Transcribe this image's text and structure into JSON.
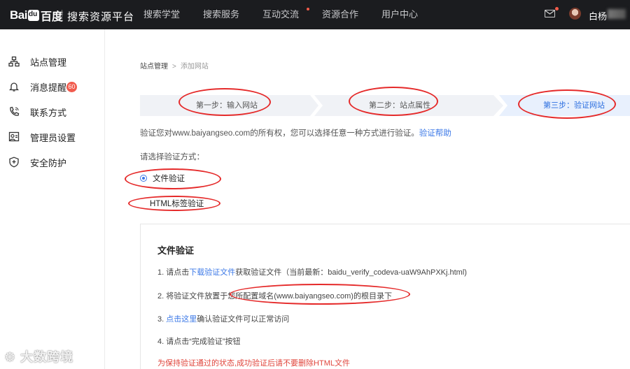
{
  "topbar": {
    "logo_text_bai": "Bai",
    "logo_text_du": "百度",
    "platform": "搜索资源平台",
    "nav": [
      "搜索学堂",
      "搜索服务",
      "互动交流",
      "资源合作",
      "用户中心"
    ],
    "username": "白杨"
  },
  "sidebar": {
    "items": [
      {
        "label": "站点管理",
        "icon": "sitemap-icon"
      },
      {
        "label": "消息提醒",
        "icon": "bell-icon",
        "badge": "60"
      },
      {
        "label": "联系方式",
        "icon": "phone-icon"
      },
      {
        "label": "管理员设置",
        "icon": "admin-icon"
      },
      {
        "label": "安全防护",
        "icon": "shield-icon"
      }
    ]
  },
  "breadcrumb": {
    "root": "站点管理",
    "current": "添加网站"
  },
  "steps": [
    "第一步：输入网站",
    "第二步：站点属性",
    "第三步：验证网站"
  ],
  "intro": {
    "text": "验证您对www.baiyangseo.com的所有权，您可以选择任意一种方式进行验证。",
    "link": "验证帮助"
  },
  "choose_label": "请选择验证方式：",
  "methods": [
    {
      "label": "文件验证",
      "selected": true
    },
    {
      "label": "HTML标签验证",
      "selected": false
    }
  ],
  "panel": {
    "title": "文件验证",
    "step1_prefix": "1.  请点击",
    "step1_link": "下载验证文件",
    "step1_suffix": "获取验证文件（当前最新：baidu_verify_codeva-uaW9AhPXKj.html)",
    "step2": "2.  将验证文件放置于您所配置域名(www.baiyangseo.com)的根目录下",
    "step3_prefix": "3.  ",
    "step3_link": "点击这里",
    "step3_suffix": "确认验证文件可以正常访问",
    "step4": "4.  请点击“完成验证”按钮",
    "warning": "为保持验证通过的状态,成功验证后请不要删除HTML文件"
  },
  "watermark": "大数跨境",
  "colors": {
    "accent": "#3b78e7",
    "topbar": "#1b1c1f",
    "annotation": "#e52a2a",
    "warning": "#e0453c"
  }
}
